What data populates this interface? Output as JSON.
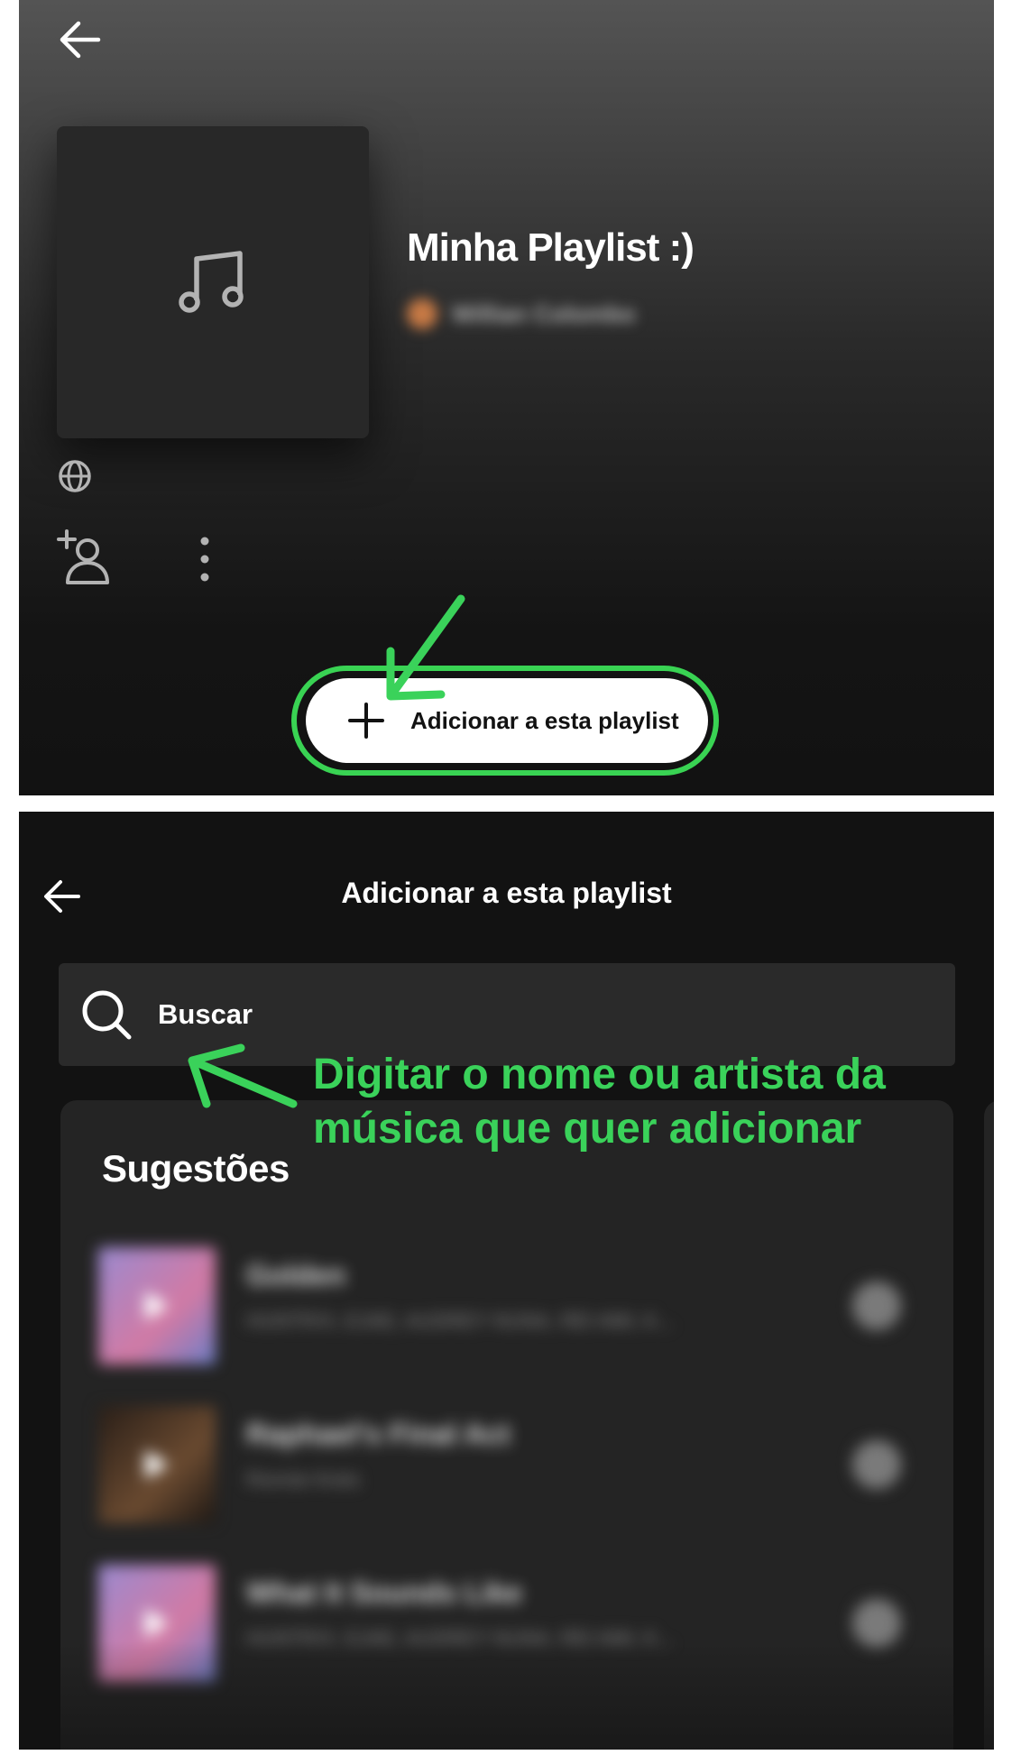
{
  "top_panel": {
    "playlist_title": "Minha Playlist :)",
    "owner_name": "Willian Colombo",
    "add_button_label": "Adicionar a esta playlist",
    "icons": [
      "back-arrow-icon",
      "music-note-icon",
      "globe-icon",
      "add-user-icon",
      "more-options-icon",
      "plus-icon"
    ]
  },
  "bottom_panel": {
    "header_title": "Adicionar a esta playlist",
    "search_placeholder": "Buscar",
    "annotation": "Digitar o nome ou artista da música que quer adicionar",
    "suggestions_title": "Sugestões",
    "tracks": [
      {
        "title": "Golden",
        "artist": "HUNTR/X, EJAE, AUDREY NUNA, REI AMI, K..."
      },
      {
        "title": "Raphael's Final Act",
        "artist": "Ronnie Kreis"
      },
      {
        "title": "What It Sounds Like",
        "artist": "HUNTR/X, EJAE, AUDREY NUNA, REI AMI, K..."
      }
    ]
  },
  "colors": {
    "accent_annotation": "#3ad25a",
    "background": "#121212",
    "card": "#242424"
  }
}
